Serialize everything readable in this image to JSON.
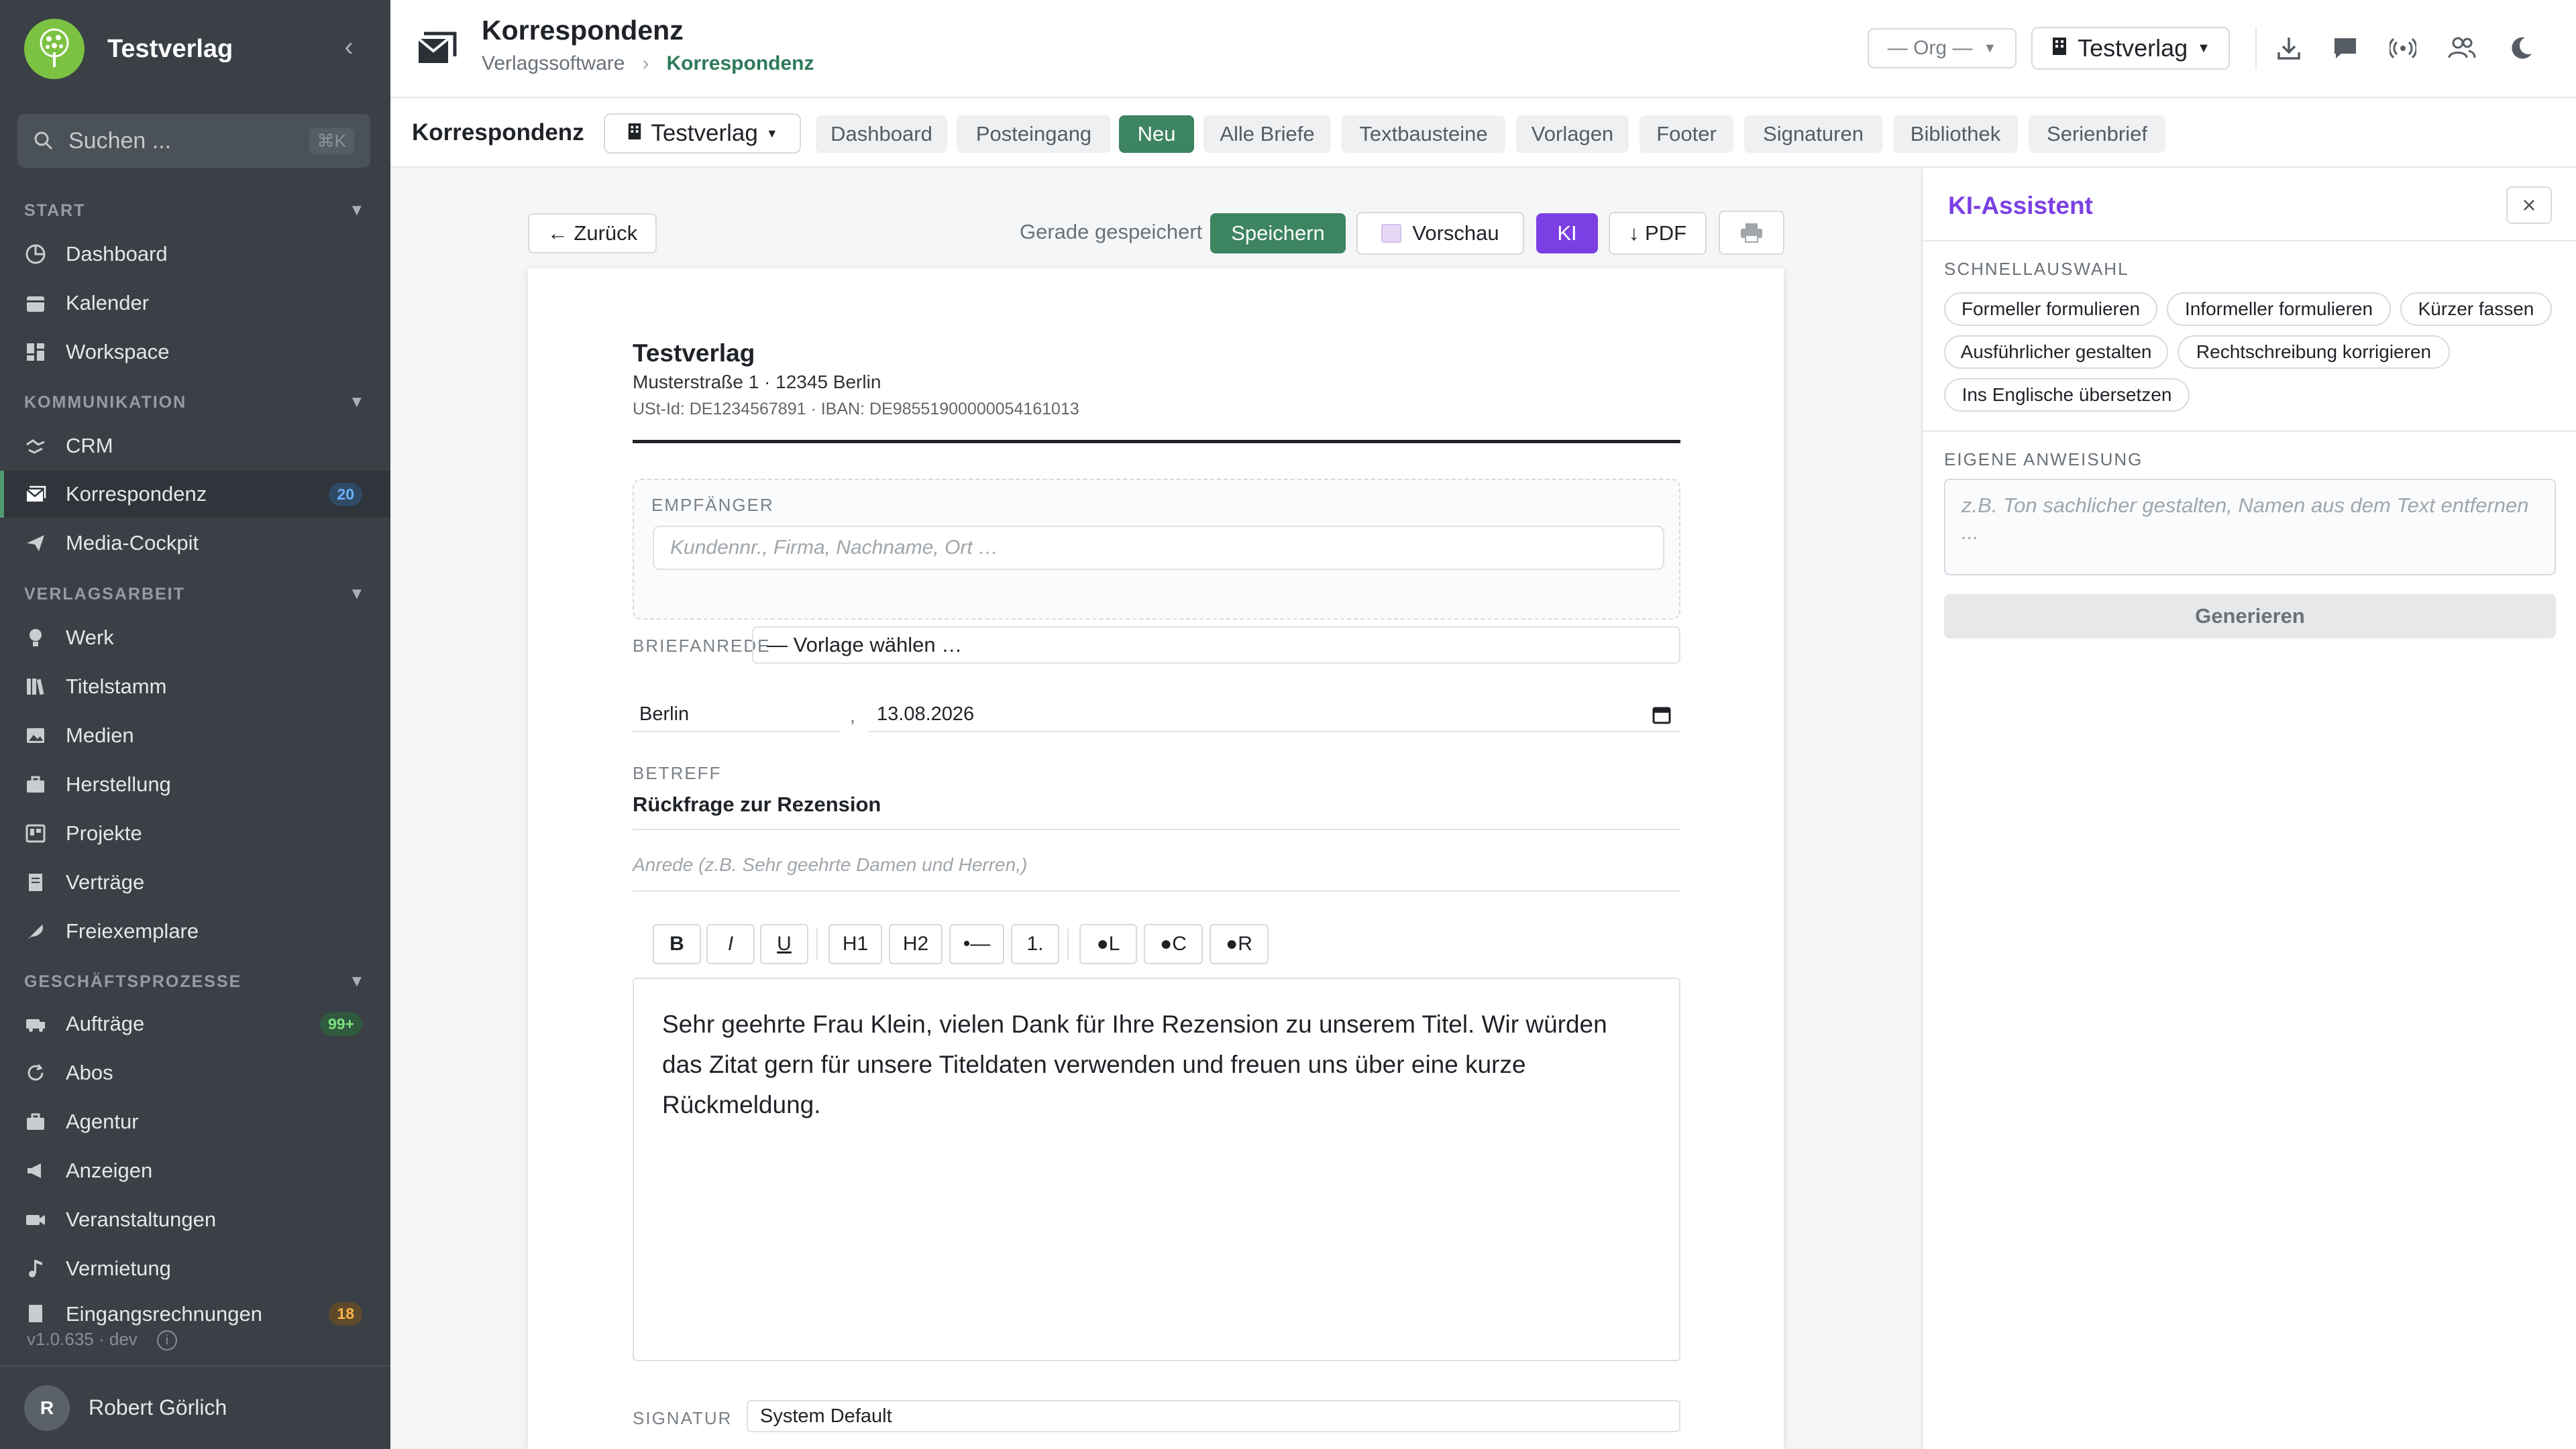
{
  "sidebar": {
    "brand": "Testverlag",
    "search": {
      "placeholder": "Suchen ...",
      "shortcut": "⌘K"
    },
    "sections": [
      {
        "label": "START"
      },
      {
        "label": "KOMMUNIKATION"
      },
      {
        "label": "VERLAGSARBEIT"
      },
      {
        "label": "GESCHÄFTSPROZESSE"
      }
    ],
    "items": [
      {
        "label": "Dashboard"
      },
      {
        "label": "Kalender"
      },
      {
        "label": "Workspace"
      },
      {
        "label": "CRM"
      },
      {
        "label": "Korrespondenz",
        "badge": "20"
      },
      {
        "label": "Media-Cockpit"
      },
      {
        "label": "Werk"
      },
      {
        "label": "Titelstamm"
      },
      {
        "label": "Medien"
      },
      {
        "label": "Herstellung"
      },
      {
        "label": "Projekte"
      },
      {
        "label": "Verträge"
      },
      {
        "label": "Freiexemplare"
      },
      {
        "label": "Aufträge",
        "badge": "99+"
      },
      {
        "label": "Abos"
      },
      {
        "label": "Agentur"
      },
      {
        "label": "Anzeigen"
      },
      {
        "label": "Veranstaltungen"
      },
      {
        "label": "Vermietung"
      },
      {
        "label": "Eingangsrechnungen",
        "badge": "18"
      }
    ],
    "version": "v1.0.635 · dev",
    "user": {
      "initial": "R",
      "name": "Robert Görlich"
    }
  },
  "header": {
    "title": "Korrespondenz",
    "breadcrumb": [
      "Verlagssoftware",
      "Korrespondenz"
    ],
    "breadcrumb_sep": "›",
    "org_select": "— Org —",
    "publisher_select": "Testverlag"
  },
  "tabbar": {
    "title": "Korrespondenz",
    "publisher": "Testverlag",
    "tabs": [
      "Dashboard",
      "Posteingang",
      "Neu",
      "Alle Briefe",
      "Textbausteine",
      "Vorlagen",
      "Footer",
      "Signaturen",
      "Bibliothek",
      "Serienbrief"
    ],
    "active_tab": "Neu"
  },
  "editor": {
    "back": "← Zurück",
    "saved_status": "Gerade gespeichert",
    "save": "Speichern",
    "preview": "Vorschau",
    "ki": "KI",
    "pdf": "↓ PDF",
    "letter": {
      "company": "Testverlag",
      "address": "Musterstraße 1 · 12345 Berlin",
      "tax": "USt-Id: DE1234567891 · IBAN: DE98551900000054161013",
      "recipient_label": "EMPFÄNGER",
      "recipient_placeholder": "Kundennr., Firma, Nachname, Ort …",
      "salutation_label": "BRIEFANREDE",
      "salutation_value": "— Vorlage wählen …",
      "city": "Berlin",
      "comma": ",",
      "date": "13.08.2026",
      "subject_label": "BETREFF",
      "subject": "Rückfrage zur Rezension",
      "greeting_placeholder": "Anrede (z.B. Sehr geehrte Damen und Herren,)",
      "toolbar": [
        "B",
        "I",
        "U",
        "H1",
        "H2",
        "•—",
        "1.",
        "●L",
        "●C",
        "●R"
      ],
      "body": "Sehr geehrte Frau Klein, vielen Dank für Ihre Rezension zu unserem Titel. Wir würden das Zitat gern für unsere Titeldaten verwenden und freuen uns über eine kurze Rückmeldung.",
      "signature_label": "SIGNATUR",
      "signature_value": "System Default"
    }
  },
  "ai_panel": {
    "title": "KI-Assistent",
    "close": "×",
    "quick_label": "SCHNELLAUSWAHL",
    "chips": [
      "Formeller formulieren",
      "Informeller formulieren",
      "Kürzer fassen",
      "Ausführlicher gestalten",
      "Rechtschreibung korrigieren",
      "Ins Englische übersetzen"
    ],
    "custom_label": "EIGENE ANWEISUNG",
    "custom_placeholder": "z.B. Ton sachlicher gestalten, Namen aus dem Text entfernen ...",
    "generate": "Generieren"
  },
  "colors": {
    "sidebar_bg": "#3a4046",
    "accent_green": "#3d8461",
    "ki_purple": "#7b3fe4",
    "brand_logo": "#7cc243"
  }
}
